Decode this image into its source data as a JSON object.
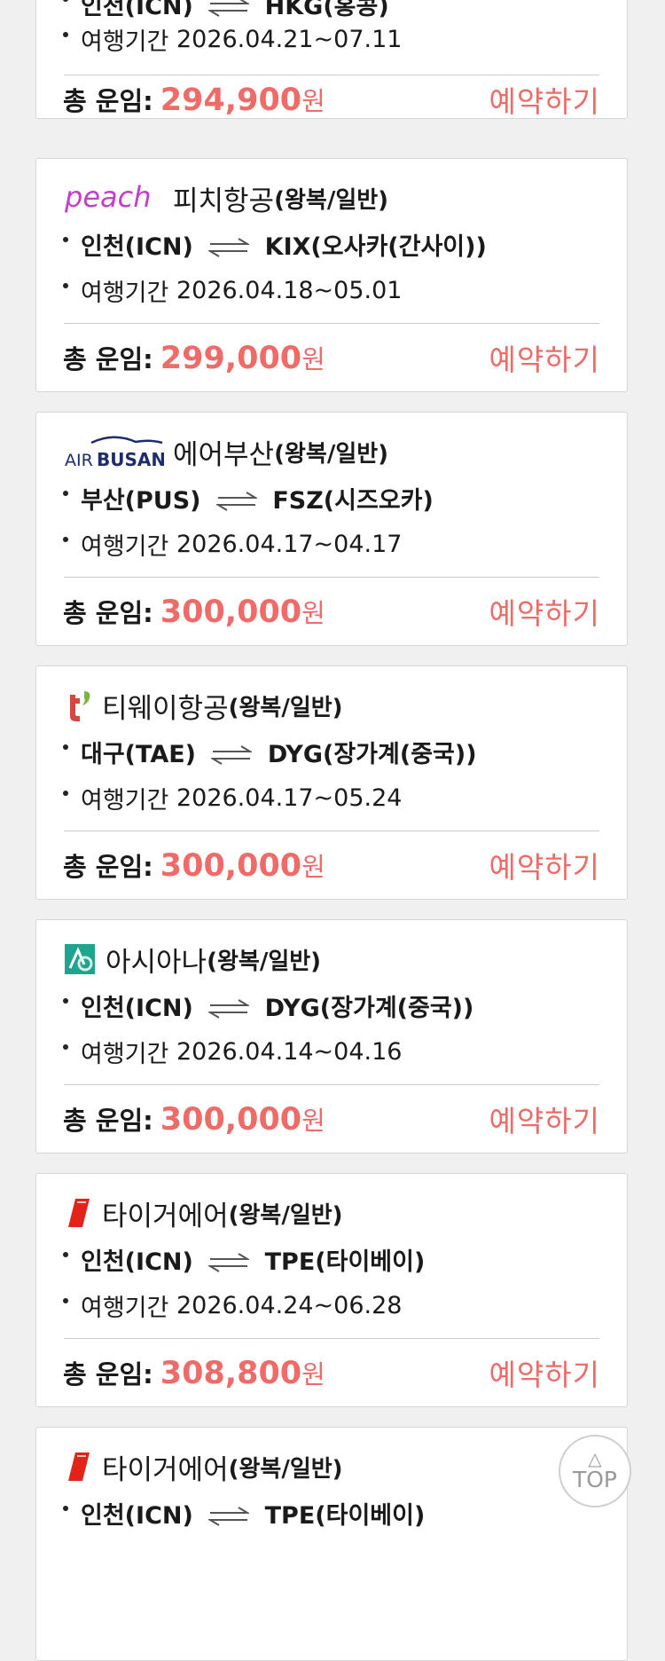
{
  "cards": [
    {
      "airline": "",
      "airline_sub": "",
      "logo": "",
      "route": "인천(ICN)",
      "dest": "HKG(홍콩)",
      "period_label": "여행기간",
      "period": "2026.04.21~07.11",
      "price_label": "총 운임:",
      "price": "294,900",
      "currency": "원",
      "book": "예약하기"
    },
    {
      "airline": "피치항공",
      "airline_sub": "(왕복/일반)",
      "logo": "peach",
      "route": "인천(ICN)",
      "dest": "KIX(오사카(간사이))",
      "period_label": "여행기간",
      "period": "2026.04.18~05.01",
      "price_label": "총 운임:",
      "price": "299,000",
      "currency": "원",
      "book": "예약하기"
    },
    {
      "airline": "에어부산",
      "airline_sub": "(왕복/일반)",
      "logo": "AIR BUSAN",
      "route": "부산(PUS)",
      "dest": "FSZ(시즈오카)",
      "period_label": "여행기간",
      "period": "2026.04.17~04.17",
      "price_label": "총 운임:",
      "price": "300,000",
      "currency": "원",
      "book": "예약하기"
    },
    {
      "airline": "티웨이항공",
      "airline_sub": "(왕복/일반)",
      "logo": "t'",
      "route": "대구(TAE)",
      "dest": "DYG(장가계(중국))",
      "period_label": "여행기간",
      "period": "2026.04.17~05.24",
      "price_label": "총 운임:",
      "price": "300,000",
      "currency": "원",
      "book": "예약하기"
    },
    {
      "airline": "아시아나",
      "airline_sub": "(왕복/일반)",
      "logo": "asiana",
      "route": "인천(ICN)",
      "dest": "DYG(장가계(중국))",
      "period_label": "여행기간",
      "period": "2026.04.14~04.16",
      "price_label": "총 운임:",
      "price": "300,000",
      "currency": "원",
      "book": "예약하기"
    },
    {
      "airline": "타이거에어",
      "airline_sub": "(왕복/일반)",
      "logo": "tigerair",
      "route": "인천(ICN)",
      "dest": "TPE(타이베이)",
      "period_label": "여행기간",
      "period": "2026.04.24~06.28",
      "price_label": "총 운임:",
      "price": "308,800",
      "currency": "원",
      "book": "예약하기"
    },
    {
      "airline": "타이거에어",
      "airline_sub": "(왕복/일반)",
      "logo": "tigerair",
      "route": "인천(ICN)",
      "dest": "TPE(타이베이)",
      "period_label": "",
      "period": "",
      "price_label": "",
      "price": "",
      "currency": "",
      "book": ""
    }
  ],
  "top_button": {
    "label": "TOP",
    "arrow": "△"
  },
  "colors": {
    "accent": "#ee6b68",
    "peach": "#c13fc9",
    "airbusan": "#1e2c6b",
    "tway": "#d6463c",
    "asiana": "#1fa58e",
    "tiger": "#e2231a"
  }
}
